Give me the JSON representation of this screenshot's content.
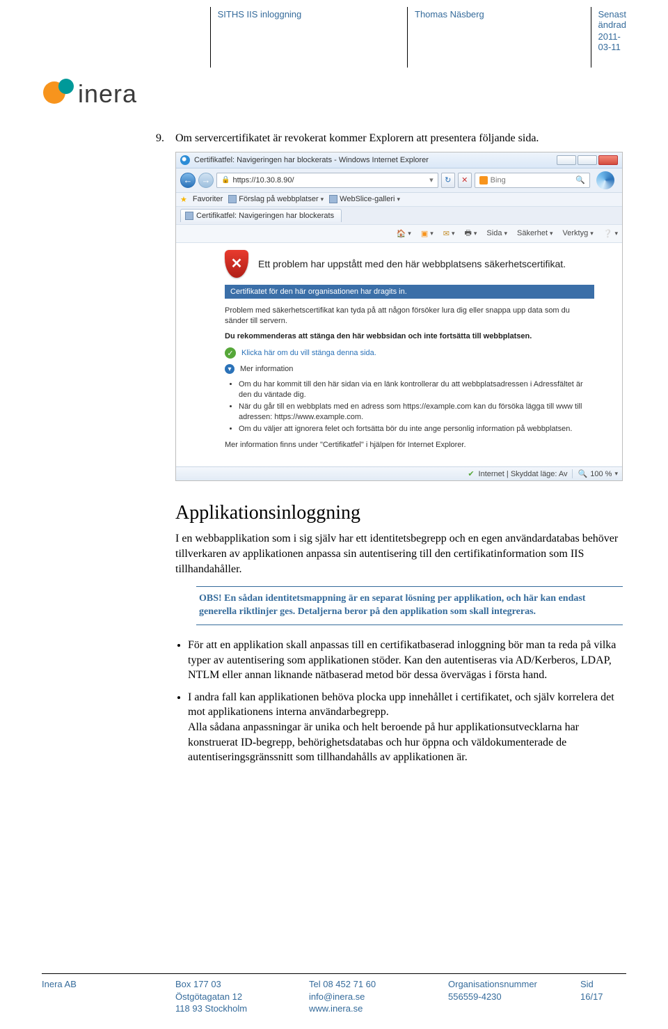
{
  "header": {
    "col2": "SITHS IIS inloggning",
    "col3": "Thomas Näsberg",
    "col4_label": "Senast ändrad",
    "col4_date": "2011-03-11"
  },
  "logo": {
    "text": "inera"
  },
  "item9": {
    "num": "9.",
    "text": "Om servercertifikatet är revokerat kommer Explorern att presentera följande sida."
  },
  "screenshot": {
    "title": "Certifikatfel: Navigeringen har blockerats - Windows Internet Explorer",
    "url": "https://10.30.8.90/",
    "search_placeholder": "Bing",
    "favorites_label": "Favoriter",
    "fav_item1": "Förslag på webbplatser",
    "fav_item2": "WebSlice-galleri",
    "tab_title": "Certifikatfel: Navigeringen har blockerats",
    "cmd_sida": "Sida",
    "cmd_sakerhet": "Säkerhet",
    "cmd_verktyg": "Verktyg",
    "warn_title": "Ett problem har uppstått med den här webbplatsens säkerhetscertifikat.",
    "blue_bar": "Certifikatet för den här organisationen har dragits in.",
    "p1": "Problem med säkerhetscertifikat kan tyda på att någon försöker lura dig eller snappa upp data som du sänder till servern.",
    "p2_bold": "Du rekommenderas att stänga den här webbsidan och inte fortsätta till webbplatsen.",
    "link_close": "Klicka här om du vill stänga denna sida.",
    "link_more": "Mer information",
    "b1": "Om du har kommit till den här sidan via en länk kontrollerar du att webbplatsadressen i Adressfältet är den du väntade dig.",
    "b2": "När du går till en webbplats med en adress som https://example.com kan du försöka lägga till www till adressen: https://www.example.com.",
    "b3": "Om du väljer att ignorera felet och fortsätta bör du inte ange personlig information på webbplatsen.",
    "p3": "Mer information finns under \"Certifikatfel\" i hjälpen för Internet Explorer.",
    "status_zone": "Internet | Skyddat läge: Av",
    "status_zoom": "100 %"
  },
  "section": {
    "title": "Applikationsinloggning",
    "intro": "I en webbapplikation som i sig själv har ett identitetsbegrepp och en egen användardatabas behöver tillverkaren av applikationen anpassa sin autentisering till den certifikatinformation som IIS tillhandahåller.",
    "note": "OBS! En sådan identitetsmappning är en separat lösning per applikation, och här kan endast generella riktlinjer ges. Detaljerna beror på den applikation som skall integreras.",
    "bullet1": "För att en applikation skall anpassas till en certifikatbaserad inloggning bör man ta reda på vilka typer av autentisering som applikationen stöder. Kan den autentiseras via AD/Kerberos, LDAP, NTLM eller annan liknande nätbaserad metod bör dessa övervägas i första hand.",
    "bullet2": "I andra fall kan applikationen behöva plocka upp innehållet i certifikatet, och själv korrelera det mot applikationens interna användarbegrepp.\nAlla sådana anpassningar är unika och helt beroende på hur applikationsutvecklarna har konstruerat ID-begrepp, behörighetsdatabas och hur öppna och väldokumenterade de autentiseringsgränssnitt som tillhandahålls av applikationen är."
  },
  "footer": {
    "company": "Inera AB",
    "addr1": "Box 177 03",
    "addr2": "Östgötagatan 12",
    "addr3": "118 93 Stockholm",
    "tel": "Tel 08 452 71 60",
    "email": "info@inera.se",
    "web": "www.inera.se",
    "org_label": "Organisationsnummer",
    "org_num": "556559-4230",
    "page": "Sid 16/17"
  }
}
